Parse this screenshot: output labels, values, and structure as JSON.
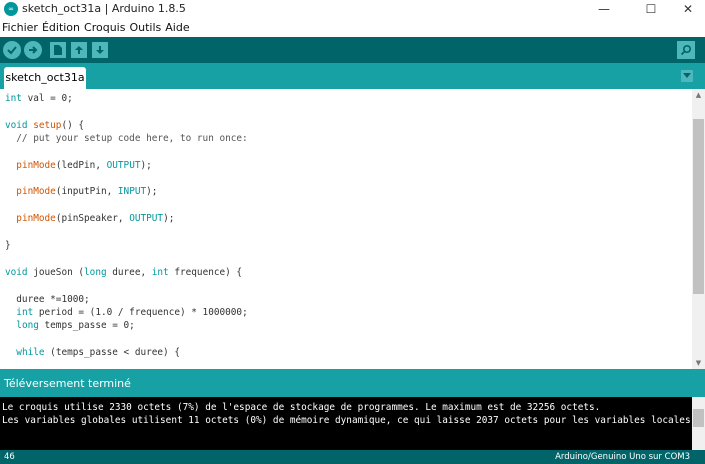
{
  "window": {
    "icon_text": "∞",
    "title": "sketch_oct31a | Arduino 1.8.5",
    "minimize": "—",
    "maximize": "☐",
    "close": "✕"
  },
  "menu": [
    "Fichier",
    "Édition",
    "Croquis",
    "Outils",
    "Aide"
  ],
  "toolbar": {
    "buttons": [
      "verify-icon",
      "upload-icon",
      "new-icon",
      "open-icon",
      "save-icon"
    ],
    "serial_monitor": "magnifier-icon"
  },
  "tab": {
    "label": "sketch_oct31a"
  },
  "code_lines": [
    "int val = 0;",
    "",
    "void setup() {",
    "  // put your setup code here, to run once:",
    "",
    "  pinMode(ledPin, OUTPUT);",
    "",
    "  pinMode(inputPin, INPUT);",
    "",
    "  pinMode(pinSpeaker, OUTPUT);",
    "",
    "}",
    "",
    "void joueSon (long duree, int frequence) {",
    "",
    "  duree *=1000;",
    "  int period = (1.0 / frequence) * 1000000;",
    "  long temps_passe = 0;",
    "",
    "  while (temps_passe < duree) {"
  ],
  "status": {
    "message": "Téléversement terminé"
  },
  "console": {
    "lines": [
      "Le croquis utilise 2330 octets (7%) de l'espace de stockage de programmes. Le maximum est de 32256 octets.",
      "Les variables globales utilisent 11 octets (0%) de mémoire dynamique, ce qui laisse 2037 octets pour les variables locales. L"
    ]
  },
  "footer": {
    "line_number": "46",
    "board": "Arduino/Genuino Uno sur COM3"
  },
  "colors": {
    "toolbar": "#006468",
    "tabbar": "#17a1a5",
    "button": "#4db7bb",
    "keyword": "#00979c",
    "function": "#d35400"
  }
}
